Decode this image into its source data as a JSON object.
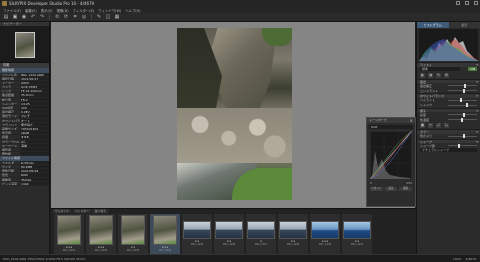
{
  "window": {
    "title": "SILKYPIX Developer Studio Pro 10 - 4/4679"
  },
  "menu": [
    "ファイル(F)",
    "編集(E)",
    "表示(V)",
    "現像(D)",
    "フィルター(E)",
    "ウィンドウ(W)",
    "ヘルプ(H)"
  ],
  "toolbar": {
    "icons": [
      "open-icon",
      "save-icon",
      "develop-icon",
      "undo-icon",
      "redo-icon",
      "rotate-left-icon",
      "rotate-right-icon",
      "crop-icon",
      "spot-icon",
      "brush-icon",
      "compare-icon",
      "grid-icon"
    ]
  },
  "left_panel": {
    "navigator_tab": "ナビゲーター",
    "info_tab": "情報",
    "info_header": "撮影情報",
    "rows": [
      {
        "k": "ファイル名",
        "v": "IMG_1234.ARW"
      },
      {
        "k": "撮影日時",
        "v": "2021/05/17"
      },
      {
        "k": "メーカー",
        "v": "SONY"
      },
      {
        "k": "カメラ",
        "v": "ILCE-7RM3"
      },
      {
        "k": "レンズ",
        "v": "FE 24-105mm"
      },
      {
        "k": "焦点距離",
        "v": "35.0mm"
      },
      {
        "k": "絞り値",
        "v": "F8.0"
      },
      {
        "k": "シャッター",
        "v": "1/125"
      },
      {
        "k": "ISO感度",
        "v": "100"
      },
      {
        "k": "露出補正",
        "v": "0.0EV"
      },
      {
        "k": "測光モード",
        "v": "マルチ"
      },
      {
        "k": "ホワイトバランス",
        "v": "オート"
      },
      {
        "k": "フラッシュ",
        "v": "発光禁止"
      },
      {
        "k": "画像サイズ",
        "v": "7952x5304"
      },
      {
        "k": "色空間",
        "v": "sRGB"
      },
      {
        "k": "評価",
        "v": "★★★"
      },
      {
        "k": "カラーラベル",
        "v": "なし"
      },
      {
        "k": "キーワード",
        "v": "海岸"
      },
      {
        "k": "撮影者",
        "v": ""
      },
      {
        "k": "著作権",
        "v": ""
      }
    ],
    "info_header2": "ファイル情報",
    "rows2": [
      {
        "k": "フォルダ",
        "v": "D:\\Photo"
      },
      {
        "k": "サイズ",
        "v": "80.6MB"
      },
      {
        "k": "更新日時",
        "v": "2021/05/18"
      },
      {
        "k": "形式",
        "v": "RAW"
      },
      {
        "k": "解像度",
        "v": "350dpi"
      },
      {
        "k": "ビット深度",
        "v": "14bit"
      }
    ]
  },
  "curve_panel": {
    "title": "トーンカーブ",
    "mode": "RGB",
    "foot_left": "0",
    "foot_right": "255",
    "buttons": [
      "リセット",
      "読込",
      "保存"
    ]
  },
  "right_panel": {
    "tabs": [
      "ヒストグラム",
      "表示"
    ],
    "sections": [
      {
        "label": "テイスト",
        "chev": "▾"
      },
      {
        "label": "露出",
        "chev": "▾"
      },
      {
        "label": "ホワイトバランス",
        "chev": "▾"
      },
      {
        "label": "調子",
        "chev": "▾"
      },
      {
        "label": "カラー",
        "chev": "▾"
      },
      {
        "label": "シャープ",
        "chev": "▾"
      }
    ],
    "preset": "標準",
    "badge": "ON",
    "sliders": [
      {
        "label": "露出補正",
        "value": 0.55
      },
      {
        "label": "コントラスト",
        "value": 0.5
      },
      {
        "label": "ハイライト",
        "value": 0.4
      },
      {
        "label": "シャドウ",
        "value": 0.62
      },
      {
        "label": "彩度",
        "value": 0.5
      },
      {
        "label": "色温度",
        "value": 0.45
      },
      {
        "label": "色かぶり",
        "value": 0.5
      },
      {
        "label": "シャープ量",
        "value": 0.35
      }
    ],
    "select_bottom": "ナチュラルシャープ",
    "icons_row1": [
      "◐",
      "◑",
      "✎",
      "⚙"
    ],
    "icons_row2": [
      "▣",
      "✂",
      "⤾",
      "⤿"
    ]
  },
  "filmstrip": {
    "tabs": [
      "サムネイル",
      "フィルター",
      "並べ替え"
    ],
    "thumbs": [
      {
        "type": "v",
        "stars": "★★★",
        "cap": "DSC_0101",
        "selected": false
      },
      {
        "type": "v",
        "stars": "★★★",
        "cap": "DSC_0102",
        "selected": false
      },
      {
        "type": "v",
        "stars": "★★",
        "cap": "DSC_0103",
        "selected": false
      },
      {
        "type": "v",
        "stars": "★★★",
        "cap": "DSC_0104",
        "selected": true
      },
      {
        "type": "h",
        "stars": "★★",
        "cap": "DSC_0105",
        "selected": false
      },
      {
        "type": "h",
        "stars": "★★",
        "cap": "DSC_0106",
        "selected": false
      },
      {
        "type": "h",
        "stars": "★",
        "cap": "DSC_0107",
        "selected": false
      },
      {
        "type": "h",
        "stars": "★★",
        "cap": "DSC_0108",
        "selected": false
      },
      {
        "type": "hb",
        "stars": "★★★",
        "cap": "DSC_0109",
        "selected": false
      },
      {
        "type": "hb",
        "stars": "★★",
        "cap": "DSC_0110",
        "selected": false
      }
    ]
  },
  "statusbar": {
    "text": "DSC_0104.ARW  7952x5304  1/125s  F8.0  ISO100  35mm",
    "right": [
      "100%",
      "4/4679"
    ]
  }
}
